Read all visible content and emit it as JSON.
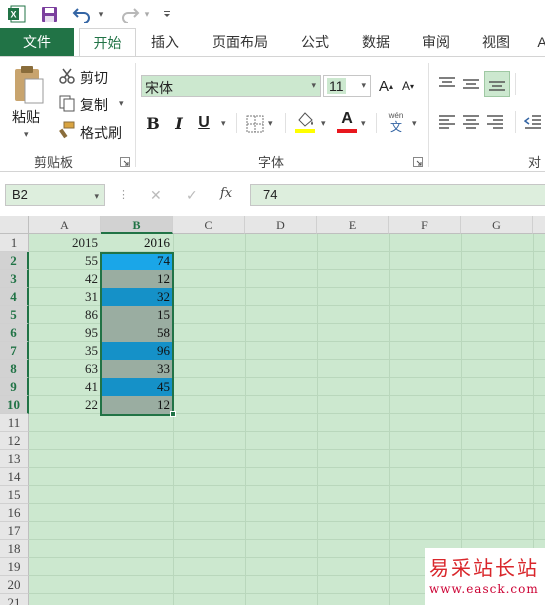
{
  "qat": {
    "undo_icon": "undo-icon",
    "redo_icon": "redo-icon"
  },
  "tabs": [
    "文件",
    "开始",
    "插入",
    "页面布局",
    "公式",
    "数据",
    "审阅",
    "视图",
    "A"
  ],
  "clipboard": {
    "paste": "粘贴",
    "cut": "剪切",
    "copy": "复制",
    "format_painter": "格式刷",
    "group": "剪贴板"
  },
  "font": {
    "name": "宋体",
    "size": "11",
    "grow": "A",
    "shrink": "A",
    "bold": "B",
    "italic": "I",
    "underline": "U",
    "font_color_letter": "A",
    "phonetic_top": "wén",
    "phonetic_bottom": "文",
    "group": "字体"
  },
  "align": {
    "group": "对"
  },
  "formula_bar": {
    "name_box": "B2",
    "fx": "fx",
    "value": "74"
  },
  "columns": [
    "A",
    "B",
    "C",
    "D",
    "E",
    "F",
    "G"
  ],
  "rows": [
    "1",
    "2",
    "3",
    "4",
    "5",
    "6",
    "7",
    "8",
    "9",
    "10",
    "11",
    "12",
    "13",
    "14",
    "15",
    "16",
    "17",
    "18",
    "19",
    "20",
    "21"
  ],
  "sheet": {
    "A": [
      "2015",
      "55",
      "42",
      "31",
      "86",
      "95",
      "35",
      "63",
      "41",
      "22"
    ],
    "B": [
      "2016",
      "74",
      "12",
      "32",
      "15",
      "58",
      "96",
      "33",
      "45",
      "12"
    ],
    "B_fill": [
      "",
      "#1aa6e8",
      "#9aada1",
      "#1591c8",
      "#9aada1",
      "#9aada1",
      "#1591c8",
      "#9aada1",
      "#1591c8",
      "#9aada1"
    ]
  },
  "colors": {
    "accent": "#217346",
    "grid_bg": "#cce8cf",
    "font_color_bar": "#e8171e",
    "highlight_bar": "#ffff00"
  },
  "watermark": {
    "cn": "易采站长站",
    "url": "www.easck.com"
  }
}
